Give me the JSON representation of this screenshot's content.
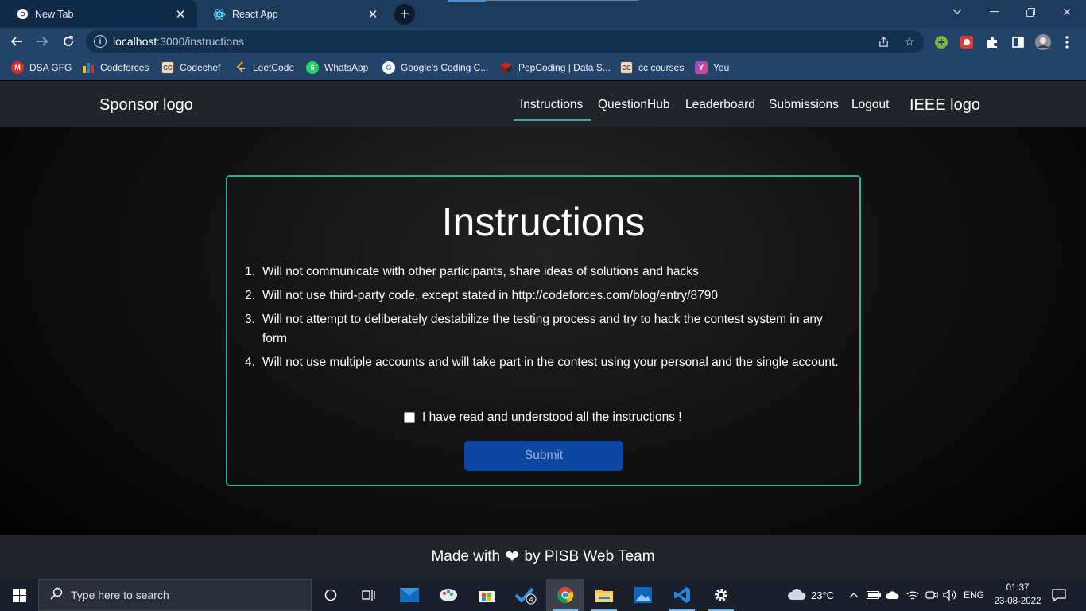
{
  "browser": {
    "tabs": [
      {
        "title": "New Tab",
        "icon": "chrome-icon"
      },
      {
        "title": "React App",
        "icon": "react-icon"
      }
    ],
    "url_host": "localhost",
    "url_path": ":3000/instructions",
    "bookmarks": [
      {
        "label": "DSA GFG",
        "color": "#d93025"
      },
      {
        "label": "Codeforces",
        "color": "#1f8acb"
      },
      {
        "label": "Codechef",
        "color": "#5b4638"
      },
      {
        "label": "LeetCode",
        "color": "#2b2b2b"
      },
      {
        "label": "WhatsApp",
        "color": "#25d366"
      },
      {
        "label": "Google's Coding C...",
        "color": "#ffffff"
      },
      {
        "label": "PepCoding | Data S...",
        "color": "#c62828"
      },
      {
        "label": "cc courses",
        "color": "#5b4638"
      },
      {
        "label": "You",
        "color": "#7e57c2"
      }
    ]
  },
  "nav": {
    "brand_left": "Sponsor logo",
    "brand_right": "IEEE logo",
    "links": [
      "Instructions",
      "QuestionHub",
      "Leaderboard",
      "Submissions",
      "Logout"
    ],
    "active": "Instructions"
  },
  "card": {
    "title": "Instructions",
    "rules": [
      "Will not communicate with other participants, share ideas of solutions and hacks",
      "Will not use third-party code, except stated in http://codeforces.com/blog/entry/8790",
      "Will not attempt to deliberately destabilize the testing process and try to hack the contest system in any form",
      "Will not use multiple accounts and will take part in the contest using your personal and the single account."
    ],
    "agree_label": "I have read and understood all the instructions !",
    "agree_checked": false,
    "submit_label": "Submit"
  },
  "footer": {
    "before": "Made with",
    "after": "by PISB Web Team"
  },
  "taskbar": {
    "search_placeholder": "Type here to search",
    "weather": "23°C",
    "language": "ENG",
    "time": "01:37",
    "date": "23-08-2022",
    "badge_count": "4"
  },
  "colors": {
    "accent": "#3aa99f",
    "submit_bg": "#0d47a1",
    "navbar_bg": "#212529"
  }
}
